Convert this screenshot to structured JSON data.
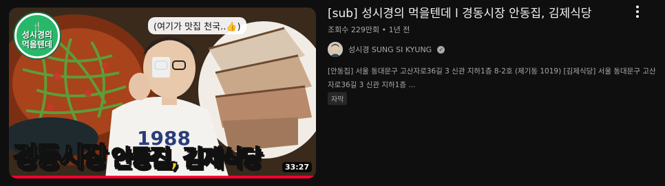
{
  "thumbnail": {
    "badge_line1": "성시경의",
    "badge_line2": "먹을텐데",
    "badge_icon": "fork-knife-icon",
    "speech": "(여기가 맛집 천국..👍)",
    "title_a": "경동시장",
    "title_b": "안동집, 김제식당",
    "duration": "33:27",
    "watched_fraction": 1.0
  },
  "video": {
    "title": "[sub] 성시경의 먹을텐데 l 경동시장 안동집, 김제식당",
    "views": "조회수 229만회",
    "separator": "•",
    "age": "1년 전",
    "channel_name": "성시경 SUNG SI KYUNG",
    "verified_icon": "verified-check-icon",
    "description": "[안동집] 서울 동대문구 고산자로36길 3 신관 지하1층 8-2호 (제기동 1019) [김제식당] 서울 동대문구 고산자로36길 3 신관 지하1층 ...",
    "caption_badge": "자막",
    "more_icon": "more-vertical-icon"
  },
  "colors": {
    "background": "#0f0f0f",
    "title": "#f1f1f1",
    "secondary": "#aaaaaa",
    "progress": "#ff0033",
    "badge_green": "#29b86a",
    "thumb_yellow": "#ffd21e"
  }
}
